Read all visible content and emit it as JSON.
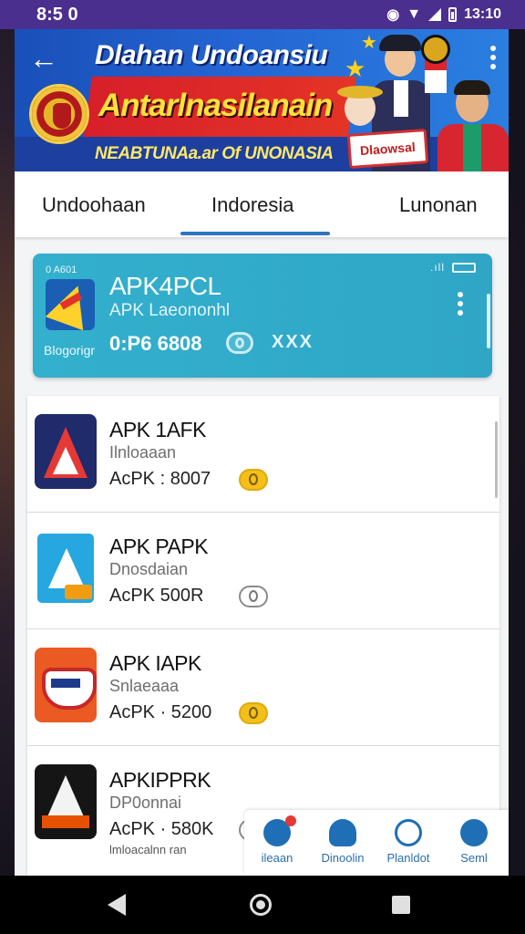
{
  "status_bar": {
    "time": "8:5 0",
    "clock_right": "13:10"
  },
  "banner": {
    "title": "Dlahan Undoansiu",
    "heading": "Antarlnasilanain",
    "subtitle": "NEABTUNAa.ar Of UNONASIA",
    "sticker": "Dlaowsal"
  },
  "tabs": [
    {
      "label": "Undoohaan"
    },
    {
      "label": "Indoresia",
      "active": true
    },
    {
      "label": "Lunonan"
    }
  ],
  "featured": {
    "small_label": "0 A601",
    "title": "APK4PCL",
    "subtitle": "APK Laeononhl",
    "price": "0:P6  6808",
    "mark": "XXX",
    "brand": "Blogorigr",
    "signal": ".ıll"
  },
  "items": [
    {
      "title": "APK 1AFK",
      "subtitle": "Ilnloaaan",
      "price": "AcPK : 8007",
      "coin": "gold",
      "note": ""
    },
    {
      "title": "APK PAPK",
      "subtitle": "Dnosdaian",
      "price": "AcPK  500R",
      "coin": "gray",
      "note": ""
    },
    {
      "title": "APK IAPK",
      "subtitle": "Snlaeaaa",
      "price": "AcPK · 5200",
      "coin": "gold",
      "note": ""
    },
    {
      "title": "APKIPPRK",
      "subtitle": "DP0onnai",
      "price": "AcPK · 580K",
      "coin": "gray",
      "note": "lmloacalnn ran"
    }
  ],
  "bottom_nav": [
    {
      "label": "ileaan",
      "icon": "chat-icon",
      "color": "#e53935"
    },
    {
      "label": "Dinoolin",
      "icon": "users-icon",
      "color": "#1e6fb6"
    },
    {
      "label": "Planldot",
      "icon": "compass-icon",
      "color": "#1e6fb6"
    },
    {
      "label": "Seml",
      "icon": "star-icon",
      "color": "#1e6fb6"
    }
  ],
  "colors": {
    "status_bar": "#4b2f8f",
    "featured_card": "#33b0cd",
    "accent": "#2f74c0"
  }
}
